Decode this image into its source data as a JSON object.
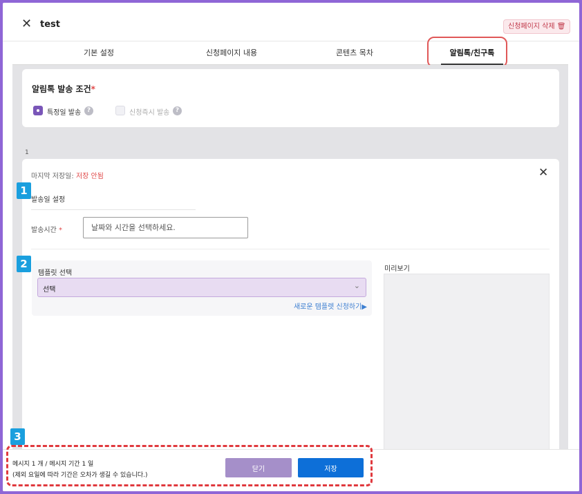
{
  "header": {
    "title": "test",
    "delete_label": "신청페이지 삭제 🗑"
  },
  "tabs": [
    {
      "label": "기본 설정"
    },
    {
      "label": "신청페이지 내용"
    },
    {
      "label": "콘텐츠 목차"
    },
    {
      "label": "알림톡/친구톡",
      "active": true
    }
  ],
  "condition": {
    "title": "알림톡 발송 조건",
    "required_mark": "*",
    "options": [
      {
        "label": "특정일 발송",
        "selected": true
      },
      {
        "label": "신청즉시 발송",
        "selected": false
      }
    ],
    "help_glyph": "?"
  },
  "page_index": "1",
  "message": {
    "last_saved_label": "마지막 저장일: ",
    "last_saved_value": "저장 안됨",
    "section1_title": "발송일 설정",
    "time_label": "발송시간 ",
    "time_required": "*",
    "time_placeholder": "날짜와 시간을 선택하세요.",
    "template_label": "템플릿 선택",
    "template_value": "선택",
    "new_template_link": "새로운 템플렛 신청하기▶",
    "preview_label": "미리보기"
  },
  "badges": [
    "1",
    "2",
    "3"
  ],
  "footer": {
    "line1": "메시지 1 개 / 메시지 기간 1 일",
    "line2": "(제외 요일에 따라 기간은 오차가 생길 수 있습니다.)",
    "close_label": "닫기",
    "save_label": "저장"
  },
  "colors": {
    "accent": "#7a56b8",
    "primary_button": "#0d6fd8",
    "highlight": "#e0393e",
    "badge": "#1a9fde"
  }
}
